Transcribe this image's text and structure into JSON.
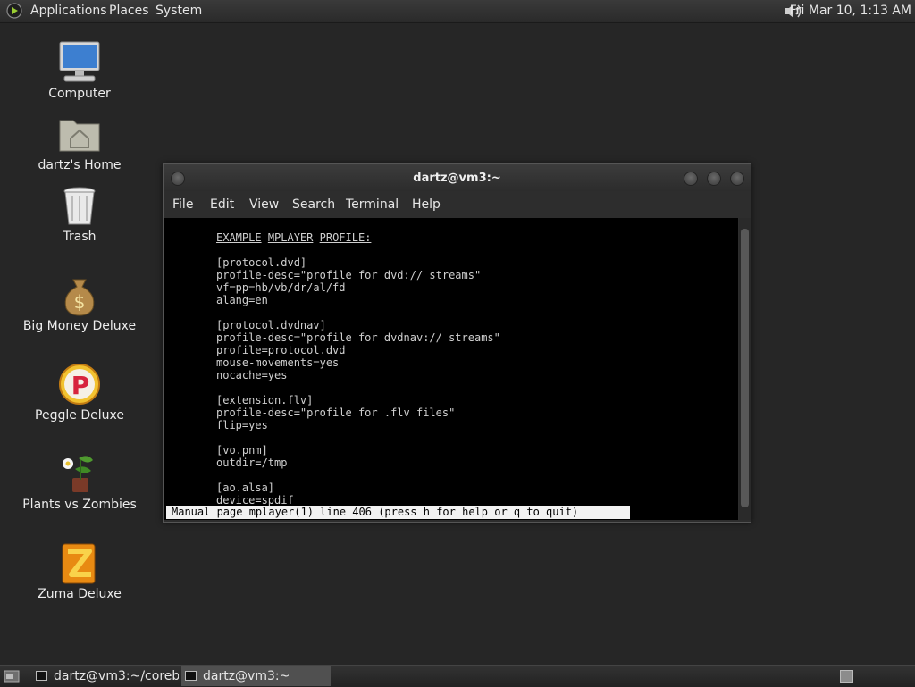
{
  "top_panel": {
    "menus": [
      "Applications",
      "Places",
      "System"
    ],
    "logo_icon": "gnome-foot-icon",
    "volume_icon": "speaker-icon",
    "clock": "Fri Mar 10,  1:13 AM"
  },
  "desktop": {
    "icons": [
      {
        "label": "Computer",
        "icon": "computer-monitor-icon"
      },
      {
        "label": "dartz's Home",
        "icon": "home-folder-icon"
      },
      {
        "label": "Trash",
        "icon": "trash-icon"
      },
      {
        "label": "Big Money Deluxe",
        "icon": "money-bag-icon"
      },
      {
        "label": "Peggle Deluxe",
        "icon": "peggle-icon"
      },
      {
        "label": "Plants vs Zombies",
        "icon": "plants-vs-zombies-icon"
      },
      {
        "label": "Zuma Deluxe",
        "icon": "zuma-icon"
      }
    ]
  },
  "terminal": {
    "title": "dartz@vm3:~",
    "menus": [
      "File",
      "Edit",
      "View",
      "Search",
      "Terminal",
      "Help"
    ],
    "heading_words": [
      "EXAMPLE",
      "MPLAYER",
      "PROFILE:"
    ],
    "lines": [
      "[protocol.dvd]",
      "profile-desc=\"profile for dvd:// streams\"",
      "vf=pp=hb/vb/dr/al/fd",
      "alang=en",
      "",
      "[protocol.dvdnav]",
      "profile-desc=\"profile for dvdnav:// streams\"",
      "profile=protocol.dvd",
      "mouse-movements=yes",
      "nocache=yes",
      "",
      "[extension.flv]",
      "profile-desc=\"profile for .flv files\"",
      "flip=yes",
      "",
      "[vo.pnm]",
      "outdir=/tmp",
      "",
      "[ao.alsa]",
      "device=spdif"
    ],
    "status_line": "Manual page mplayer(1) line 406 (press h for help or q to quit)"
  },
  "taskbar": {
    "show_desktop_icon": "show-desktop-icon",
    "tasks": [
      {
        "label": "dartz@vm3:~/coreb…",
        "icon": "terminal-icon"
      },
      {
        "label": "dartz@vm3:~",
        "icon": "terminal-icon"
      }
    ],
    "workspace_icon": "workspace-switcher-icon"
  }
}
